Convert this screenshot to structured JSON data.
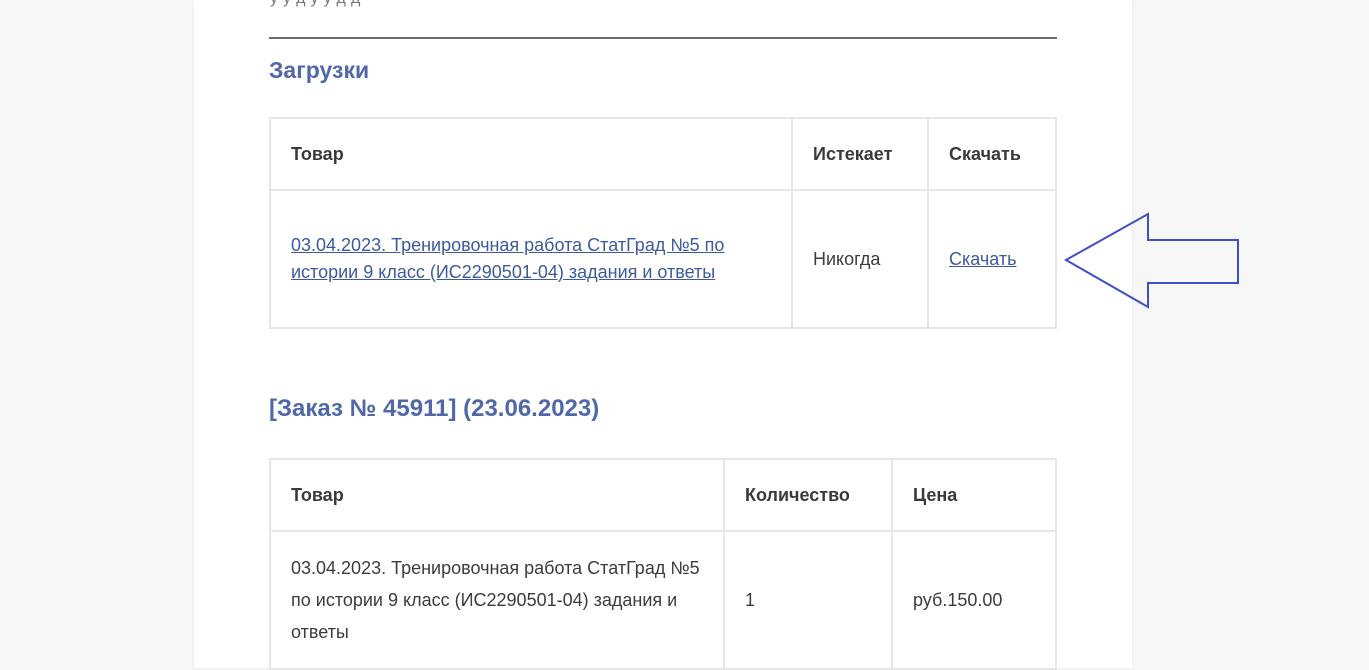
{
  "top_cut_text": "у у д у у д д",
  "downloads": {
    "title": "Загрузки",
    "headers": [
      "Товар",
      "Истекает",
      "Скачать"
    ],
    "row": {
      "product_link": "03.04.2023. Тренировочная работа СтатГрад №5 по истории 9 класс (ИС2290501-04) задания и ответы",
      "expires": "Никогда",
      "download_link": "Скачать"
    }
  },
  "order": {
    "title": "[Заказ № 45911] (23.06.2023)",
    "headers": [
      "Товар",
      "Количество",
      "Цена"
    ],
    "row": {
      "product": "03.04.2023. Тренировочная работа СтатГрад №5 по истории 9 класс (ИС2290501-04) задания и ответы",
      "quantity": "1",
      "price": "руб.150.00"
    }
  },
  "annotation": {
    "icon": "left-arrow-outline-icon",
    "color": "#3f4fc4"
  }
}
